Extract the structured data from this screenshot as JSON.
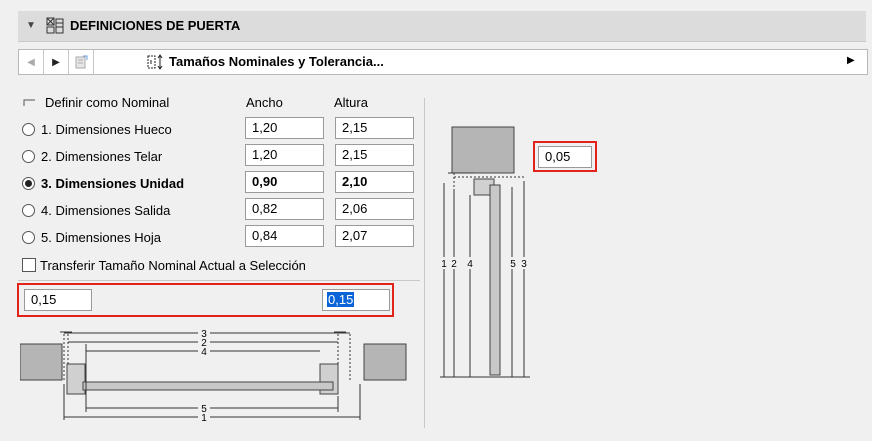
{
  "header": {
    "title": "DEFINICIONES DE PUERTA",
    "icon": "door-settings-icon"
  },
  "navbar": {
    "selected": "Tamaños Nominales y Tolerancia...",
    "icon": "size-tolerance-icon"
  },
  "columns": {
    "nominal_label": "Definir como Nominal",
    "width": "Ancho",
    "height": "Altura"
  },
  "rows": [
    {
      "label": "1. Dimensiones Hueco",
      "width": "1,20",
      "height": "2,15",
      "selected": false
    },
    {
      "label": "2. Dimensiones Telar",
      "width": "1,20",
      "height": "2,15",
      "selected": false
    },
    {
      "label": "3. Dimensiones Unidad",
      "width": "0,90",
      "height": "2,10",
      "selected": true
    },
    {
      "label": "4. Dimensiones Salida",
      "width": "0,82",
      "height": "2,06",
      "selected": false
    },
    {
      "label": "5. Dimensiones Hoja",
      "width": "0,84",
      "height": "2,07",
      "selected": false
    }
  ],
  "transfer": {
    "label": "Transferir Tamaño Nominal Actual a Selección",
    "checked": false
  },
  "tolerance": {
    "left": "0,15",
    "right": "0,15",
    "top_value": "0,05"
  },
  "diagram_h": {
    "labels": [
      "3",
      "2",
      "4",
      "5",
      "1"
    ]
  },
  "diagram_v": {
    "labels": [
      "1",
      "2",
      "4",
      "5",
      "3"
    ]
  },
  "colors": {
    "highlight": "#e0241a",
    "selection": "#0a64d8"
  }
}
